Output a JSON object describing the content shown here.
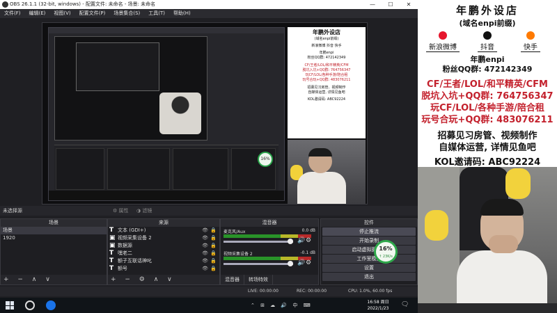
{
  "window": {
    "title": "OBS 26.1.1 (32-bit, windows) - 配置文件: 未命名 - 场景: 未命名",
    "min": "—",
    "max": "☐",
    "close": "✕"
  },
  "menu": [
    "文件(F)",
    "编辑(E)",
    "视图(V)",
    "配置文件(P)",
    "场景集合(S)",
    "工具(T)",
    "帮助(H)"
  ],
  "preview_overlay": {
    "title": "年鹏外设店",
    "subtitle": "(域名enpi前缀)",
    "social": [
      "新浪微博",
      "抖音",
      "快手"
    ],
    "nick": "年鹏enpi",
    "fans": "粉丝QQ群: 472142349",
    "l1": "CF/王者/LOL/和平精英/CFM",
    "l2": "脱坑入坑+QQ群: 764756347",
    "l3": "玩CF/LOL/各种手游/陪合租",
    "l4": "玩号合玩+QQ群: 483076211",
    "l5": "招募见习房管、视频制作",
    "l6": "自媒体运营, 详情见鱼吧",
    "l7": "KOL邀请码: ABC92224",
    "badge": "16%"
  },
  "cursor_row": {
    "no_source": "未选择源",
    "properties": "属性",
    "filters": "滤镜"
  },
  "scenes": {
    "header": "场景",
    "items": [
      "场景",
      "1920"
    ],
    "footer": "+ − ∧ ∨"
  },
  "sources": {
    "header": "来源",
    "items": [
      {
        "icon": "T",
        "label": "文本 (GDI+)"
      },
      {
        "icon": "▣",
        "label": "视频采集设备 2"
      },
      {
        "icon": "▣",
        "label": "数据源"
      },
      {
        "icon": "T",
        "label": "嘿老二"
      },
      {
        "icon": "T",
        "label": "额子互联话神叱"
      },
      {
        "icon": "T",
        "label": "额号"
      }
    ],
    "eye": "👁",
    "lock": "🔒",
    "footer": "+ − ⚙ ∧ ∨"
  },
  "mixer": {
    "header": "混音器",
    "channels": [
      {
        "label": "麦克风/Aux",
        "db": "0.0 dB"
      },
      {
        "label": "视频采集设备 2",
        "db": "-0.1 dB"
      }
    ],
    "speaker": "🔊",
    "gear": "⚙",
    "tabs": [
      "混音器",
      "转场特效"
    ]
  },
  "controls": {
    "header": "控件",
    "buttons": [
      "停止推流",
      "开始录制",
      "启动虚拟摄像机",
      "工作室模式",
      "设置",
      "退出"
    ],
    "net_percent": "16%",
    "net_speed": "↑ 23K/s"
  },
  "status": {
    "live": "LIVE: 00:00:00",
    "rec": "REC: 00:00:00",
    "cpu": "CPU: 1.0%, 60.00 fps"
  },
  "taskbar": {
    "tray": "⌃ ⊞ ☁ 🔊 中 ⌨",
    "time": "16:58 周日",
    "date": "2022/1/23",
    "notif": "🗨"
  },
  "panel": {
    "title": "年鹏外设店",
    "subtitle": "(域名enpi前缀)",
    "social": [
      {
        "name": "新浪微博",
        "color": "#e6162d"
      },
      {
        "name": "抖音",
        "color": "#111111"
      },
      {
        "name": "快手",
        "color": "#ff7a00"
      }
    ],
    "nick": "年鹏enpi",
    "fans": "粉丝QQ群: 472142349",
    "games1": "CF/王者/LOL/和平精英/CFM",
    "qq1": "脱坑入坑+QQ群: 764756347",
    "games2": "玩CF/LOL/各种手游/陪合租",
    "qq2": "玩号合玩+QQ群: 483076211",
    "recruit1": "招募见习房管、视频制作",
    "recruit2": "自媒体运营, 详情见鱼吧",
    "kol": "KOL邀请码: ABC92224"
  },
  "colors": {
    "accent_red": "#c3202c",
    "ok_green": "#2fa84b",
    "dark_bg": "#1f1f23"
  }
}
